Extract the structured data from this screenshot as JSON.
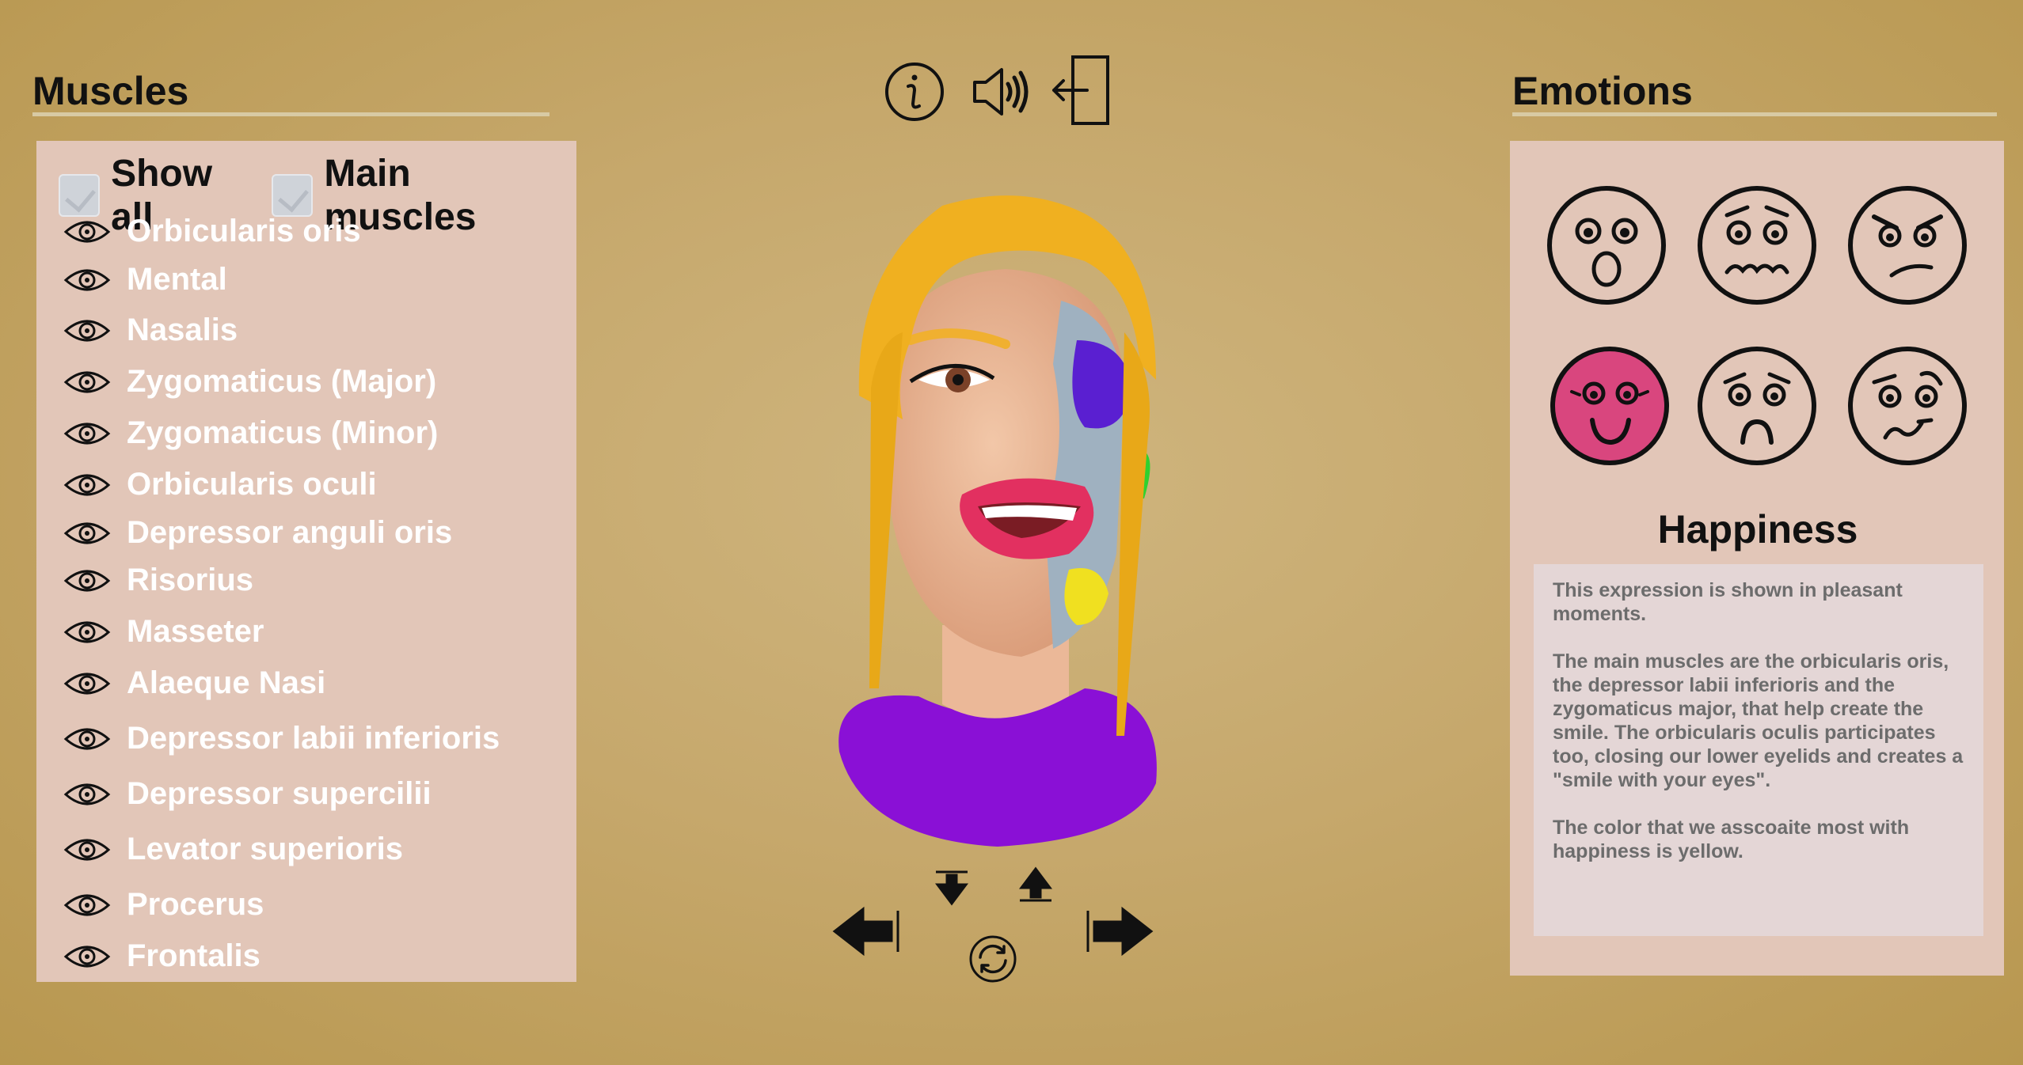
{
  "muscles_panel": {
    "title": "Muscles",
    "show_all_label": "Show all",
    "main_muscles_label": "Main muscles",
    "items": [
      "Orbicularis oris",
      "Mental",
      "Nasalis",
      "Zygomaticus (Major)",
      "Zygomaticus (Minor)",
      "Orbicularis oculi",
      "Depressor anguli oris",
      "Risorius",
      "Masseter",
      "Alaeque Nasi",
      "Depressor labii inferioris",
      "Depressor supercilii",
      "Levator superioris",
      "Procerus",
      "Frontalis"
    ]
  },
  "toolbar": {
    "icons": [
      "info-icon",
      "sound-icon",
      "exit-icon"
    ]
  },
  "emotions_panel": {
    "title": "Emotions",
    "faces": [
      "surprise",
      "fear",
      "anger",
      "happiness",
      "sadness",
      "disgust"
    ],
    "selected": "happiness",
    "selected_name": "Happiness",
    "description": [
      "This expression is shown in pleasant moments.",
      "The main muscles are the orbicularis oris, the depressor labii inferioris  and the zygomaticus major, that help create the smile. The orbicularis oculis participates too, closing our lower eyelids and creates a \"smile with your eyes\".",
      "The color that we asscoaite most with happiness is yellow."
    ]
  },
  "colors": {
    "background": "#c6a86c",
    "panel": "#e2c6b8",
    "selected_face": "#d9467e"
  },
  "navigation": {
    "icons": [
      "arrow-down-icon",
      "arrow-up-icon",
      "arrow-left-icon",
      "arrow-right-icon",
      "reset-rotation-icon"
    ]
  }
}
